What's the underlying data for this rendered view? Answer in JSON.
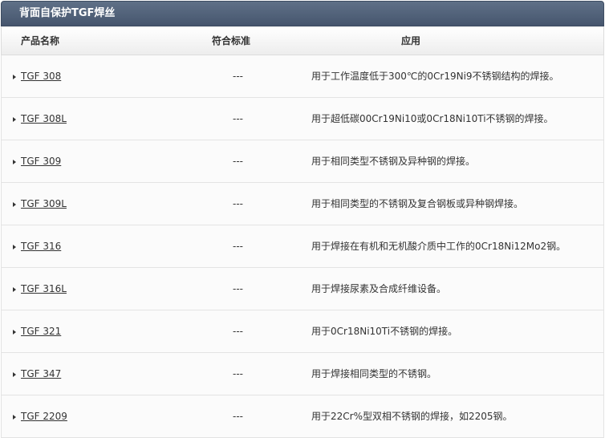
{
  "panel": {
    "title": "背面自保护TGF焊丝"
  },
  "table": {
    "headers": {
      "name": "产品名称",
      "standard": "符合标准",
      "application": "应用"
    },
    "rows": [
      {
        "name": "TGF 308",
        "standard": "---",
        "application": "用于工作温度低于300℃的0Cr19Ni9不锈钢结构的焊接。"
      },
      {
        "name": "TGF 308L",
        "standard": "---",
        "application": "用于超低碳00Cr19Ni10或0Cr18Ni10Ti不锈钢的焊接。"
      },
      {
        "name": "TGF 309",
        "standard": "---",
        "application": "用于相同类型不锈钢及异种钢的焊接。"
      },
      {
        "name": "TGF 309L",
        "standard": "---",
        "application": "用于相同类型的不锈钢及复合钢板或异种钢焊接。"
      },
      {
        "name": "TGF 316",
        "standard": "---",
        "application": "用于焊接在有机和无机酸介质中工作的0Cr18Ni12Mo2钢。"
      },
      {
        "name": "TGF 316L",
        "standard": "---",
        "application": "用于焊接尿素及合成纤维设备。"
      },
      {
        "name": "TGF 321",
        "standard": "---",
        "application": "用于0Cr18Ni10Ti不锈钢的焊接。"
      },
      {
        "name": "TGF 347",
        "standard": "---",
        "application": "用于焊接相同类型的不锈钢。"
      },
      {
        "name": "TGF 2209",
        "standard": "---",
        "application": "用于22Cr%型双相不锈钢的焊接，如2205钢。"
      }
    ]
  },
  "icons": {
    "row_bullet": "triangle-right-icon"
  },
  "colors": {
    "title_bar": "#4e5e76",
    "text": "#333333",
    "row_border": "#e3e3e3"
  }
}
